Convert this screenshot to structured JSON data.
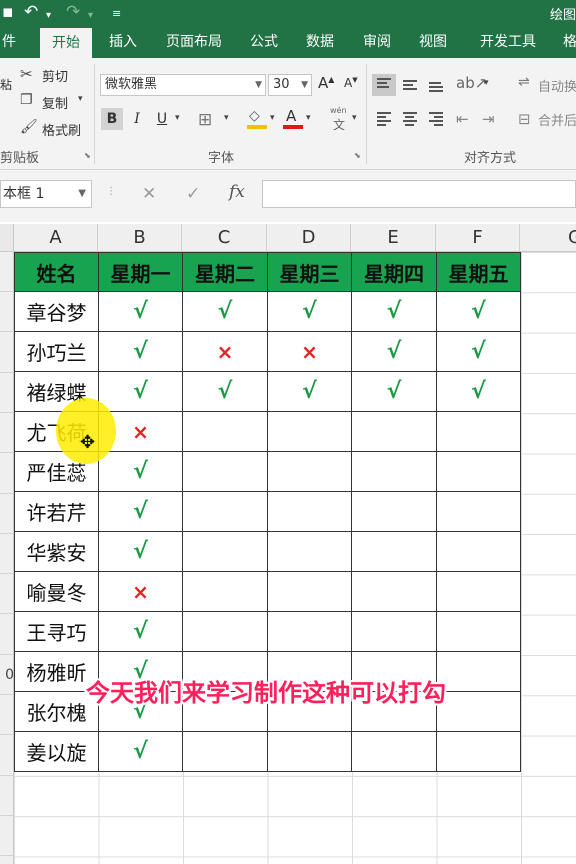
{
  "titlebar": {
    "title": "绘图",
    "undo_icon": "undo-icon",
    "redo_icon": "redo-icon",
    "customize_icon": "customize-quick-access-icon"
  },
  "tabs": [
    "件",
    "开始",
    "插入",
    "页面布局",
    "公式",
    "数据",
    "审阅",
    "视图",
    "开发工具",
    "格"
  ],
  "active_tab": "开始",
  "ribbon": {
    "clipboard": {
      "cut": "剪切",
      "copy": "复制",
      "format_painter": "格式刷",
      "paste_partial": "粘",
      "label": "剪贴板"
    },
    "font": {
      "font_name": "微软雅黑",
      "font_size": "30",
      "bold": "B",
      "italic": "I",
      "underline": "U",
      "phonetic": "wén",
      "label": "字体",
      "fill_color": "#f5c000",
      "font_color": "#e01818"
    },
    "alignment": {
      "wrap_text": "自动换",
      "merge_center": "合并后",
      "label": "对齐方式"
    }
  },
  "formula_bar": {
    "name_box": "本框 1",
    "fx": "fx",
    "formula": ""
  },
  "grid": {
    "columns": [
      "A",
      "B",
      "C",
      "D",
      "E",
      "F",
      "G"
    ],
    "row_numbers": [
      "",
      "",
      "",
      "",
      "",
      "",
      "",
      "",
      "",
      "",
      "0",
      "",
      "",
      "",
      "",
      ""
    ]
  },
  "table": {
    "headers": [
      "姓名",
      "星期一",
      "星期二",
      "星期三",
      "星期四",
      "星期五"
    ],
    "header_color": "#17a34f",
    "check_symbol": "√",
    "cross_symbol": "×",
    "rows": [
      {
        "name": "章谷梦",
        "marks": [
          "√",
          "√",
          "√",
          "√",
          "√"
        ]
      },
      {
        "name": "孙巧兰",
        "marks": [
          "√",
          "×",
          "×",
          "√",
          "√"
        ]
      },
      {
        "name": "褚绿蝶",
        "marks": [
          "√",
          "√",
          "√",
          "√",
          "√"
        ]
      },
      {
        "name": "尤飞荷",
        "marks": [
          "×",
          "",
          "",
          "",
          ""
        ]
      },
      {
        "name": "严佳蕊",
        "marks": [
          "√",
          "",
          "",
          "",
          ""
        ]
      },
      {
        "name": "许若芹",
        "marks": [
          "√",
          "",
          "",
          "",
          ""
        ]
      },
      {
        "name": "华紫安",
        "marks": [
          "√",
          "",
          "",
          "",
          ""
        ]
      },
      {
        "name": "喻曼冬",
        "marks": [
          "×",
          "",
          "",
          "",
          ""
        ]
      },
      {
        "name": "王寻巧",
        "marks": [
          "√",
          "",
          "",
          "",
          ""
        ]
      },
      {
        "name": "杨雅昕",
        "marks": [
          "√",
          "",
          "",
          "",
          ""
        ]
      },
      {
        "name": "张尔槐",
        "marks": [
          "√",
          "",
          "",
          "",
          ""
        ]
      },
      {
        "name": "姜以旋",
        "marks": [
          "√",
          "",
          "",
          "",
          ""
        ]
      }
    ]
  },
  "caption": "今天我们来学习制作这种可以打勾"
}
